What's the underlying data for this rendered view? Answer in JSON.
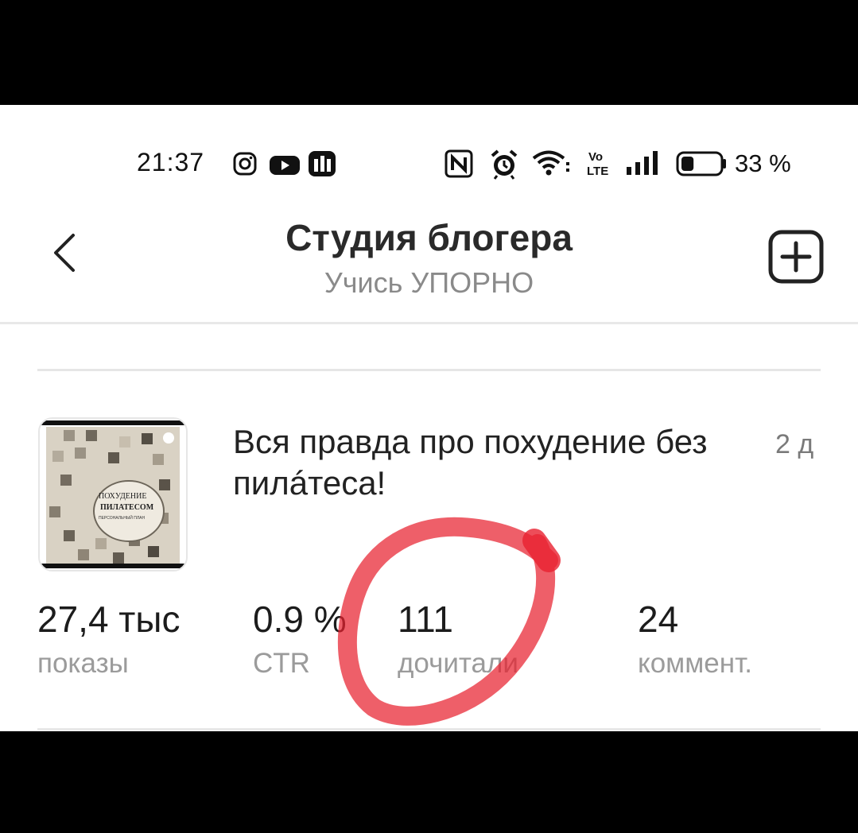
{
  "status_bar": {
    "time": "21:37",
    "battery_percent": "33 %",
    "battery_level": 0.33,
    "icons": [
      "instagram-icon",
      "youtube-icon",
      "app-icon",
      "nfc-icon",
      "alarm-icon",
      "wifi-icon",
      "volte-icon",
      "signal-icon",
      "battery-icon"
    ]
  },
  "header": {
    "title": "Студия блогера",
    "subtitle": "Учись УПОРНО",
    "back_icon": "chevron-left-icon",
    "add_icon": "plus-square-icon"
  },
  "post": {
    "title": "Вся правда про похудение без пилáтеса!",
    "age": "2 д",
    "thumbnail_text": [
      "ПОХУДЕНИЕ",
      "ПИЛАТЕСОМ",
      "ПЕРСОНАЛЬНЫЙ ПЛАН"
    ],
    "stats": [
      {
        "value": "27,4 тыс",
        "label": "показы"
      },
      {
        "value": "0.9 %",
        "label": "CTR"
      },
      {
        "value": "111",
        "label": "дочитали"
      },
      {
        "value": "24",
        "label": "коммент."
      }
    ]
  },
  "annotation": {
    "color": "#e8212f",
    "type": "hand-drawn circle around 111 дочитали"
  }
}
